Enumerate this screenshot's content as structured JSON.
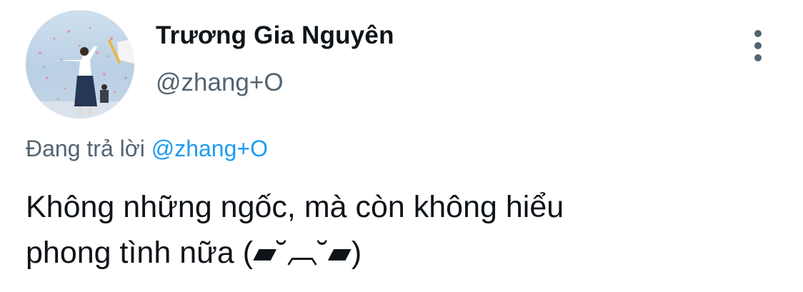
{
  "author": {
    "display_name": "Trương Gia Nguyên",
    "handle": "@zhang+O",
    "avatar": "avatar-photo"
  },
  "more_icon": "more-vertical-icon",
  "reply": {
    "prefix": "Đang trả lời",
    "mention": "@zhang+O"
  },
  "tweet": {
    "line1": "Không những ngốc, mà còn không hiểu",
    "line2": "phong tình nữa (▰˘︹˘▰)"
  },
  "colors": {
    "text": "#0f1419",
    "secondary": "#536471",
    "link": "#1d9bf0"
  }
}
